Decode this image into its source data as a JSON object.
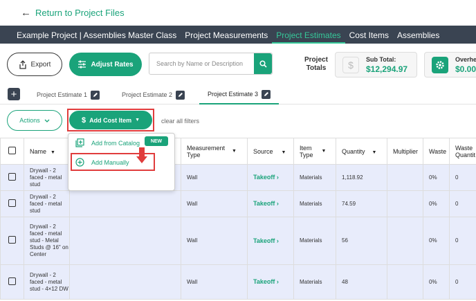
{
  "back_link": "Return to Project Files",
  "nav": {
    "items": [
      "Example Project | Assemblies Master Class",
      "Project Measurements",
      "Project Estimates",
      "Cost Items",
      "Assemblies"
    ],
    "active_index": 2
  },
  "toolbar": {
    "export_label": "Export",
    "adjust_rates_label": "Adjust Rates",
    "search_placeholder": "Search by Name or Description",
    "totals_label_line1": "Project",
    "totals_label_line2": "Totals",
    "subtotal_label": "Sub Total:",
    "subtotal_value": "$12,294.97",
    "overhead_label": "Overhead",
    "overhead_value": "$0.00"
  },
  "tabs": [
    "Project Estimate 1",
    "Project Estimate 2",
    "Project Estimate 3"
  ],
  "active_tab": 2,
  "filters": {
    "actions_label": "Actions",
    "add_cost_label": "Add Cost Item",
    "clear_label": "clear all filters"
  },
  "dropdown": {
    "catalog_label": "Add from Catalog",
    "new_badge": "NEW",
    "manual_label": "Add Manually"
  },
  "table": {
    "headers": {
      "name": "Name",
      "measurement_type_1": "Measurement",
      "measurement_type_2": "Type",
      "source": "Source",
      "item_type_1": "Item",
      "item_type_2": "Type",
      "quantity": "Quantity",
      "multiplier": "Multiplier",
      "waste": "Waste",
      "waste_qty_1": "Waste",
      "waste_qty_2": "Quantit"
    },
    "rows": [
      {
        "name": "Drywall - 2 faced - metal stud",
        "measurement_type": "Wall",
        "source": "Takeoff",
        "item_type": "Materials",
        "quantity": "1,118.92",
        "multiplier": "",
        "waste": "0%",
        "waste_qty": "0"
      },
      {
        "name": "Drywall - 2 faced - metal stud",
        "measurement_type": "Wall",
        "source": "Takeoff",
        "item_type": "Materials",
        "quantity": "74.59",
        "multiplier": "",
        "waste": "0%",
        "waste_qty": "0"
      },
      {
        "name": "Drywall - 2 faced - metal stud - Metal Studs @ 16\" on Center",
        "measurement_type": "Wall",
        "source": "Takeoff",
        "item_type": "Materials",
        "quantity": "56",
        "multiplier": "",
        "waste": "0%",
        "waste_qty": "0"
      },
      {
        "name": "Drywall - 2 faced - metal stud - 4×12 DW",
        "measurement_type": "Wall",
        "source": "Takeoff",
        "item_type": "Materials",
        "quantity": "48",
        "multiplier": "",
        "waste": "0%",
        "waste_qty": "0"
      }
    ]
  },
  "colors": {
    "accent": "#1aa37a",
    "nav_bg": "#3a4452",
    "highlight_red": "#e03c3c",
    "row_bg": "#e8ecfb"
  }
}
